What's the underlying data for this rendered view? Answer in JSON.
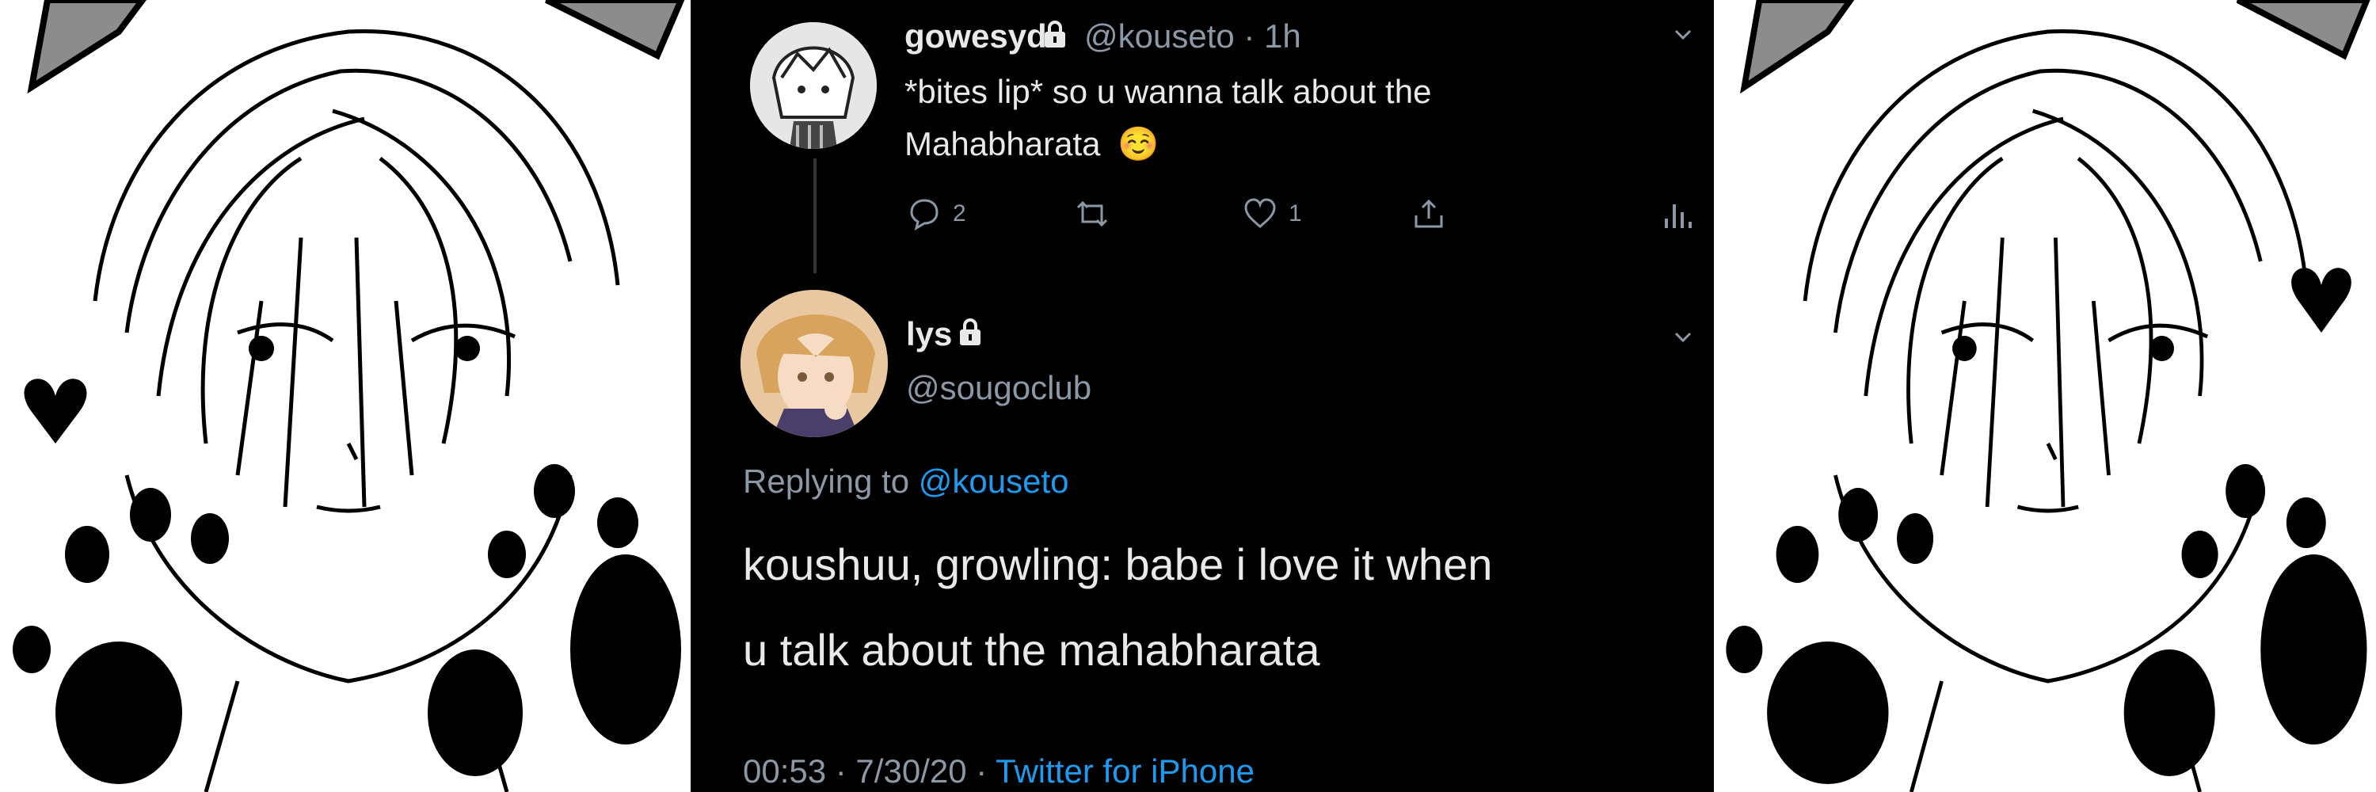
{
  "tweets": [
    {
      "display_name": "gowesyd",
      "handle": "@kouseto",
      "time": "1h",
      "text_line1": "*bites lip* so u wanna talk about the",
      "text_line2": "Mahabharata",
      "emoji": "☺️",
      "reply_count": "2",
      "like_count": "1"
    },
    {
      "display_name": "lys",
      "handle": "@sougoclub",
      "replying_prefix": "Replying to",
      "replying_handle": "@kouseto",
      "text_line1": "koushuu, growling: babe i love it when",
      "text_line2": "u talk about the mahabharata",
      "timestamp": "00:53 · 7/30/20 ·",
      "source": "Twitter for iPhone"
    }
  ],
  "icons": {
    "lock": "lock-icon",
    "reply": "reply-icon",
    "retweet": "retweet-icon",
    "like": "heart-icon",
    "share": "share-icon",
    "analytics": "analytics-icon",
    "caret": "chevron-down-icon"
  },
  "colors": {
    "background": "#000000",
    "text": "#e7e9ea",
    "muted": "#8b98a5",
    "link": "#1d9bf0"
  }
}
